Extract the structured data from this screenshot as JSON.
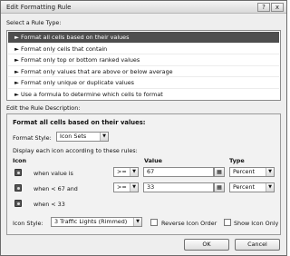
{
  "window": {
    "title": "Edit Formatting Rule",
    "help_glyph": "?",
    "close_glyph": "x"
  },
  "select_rule_type": {
    "label": "Select a Rule Type:",
    "items": [
      {
        "label": "Format all cells based on their values"
      },
      {
        "label": "Format only cells that contain"
      },
      {
        "label": "Format only top or bottom ranked values"
      },
      {
        "label": "Format only values that are above or below average"
      },
      {
        "label": "Format only unique or duplicate values"
      },
      {
        "label": "Use a formula to determine which cells to format"
      }
    ],
    "selected_index": 0,
    "arrow_glyph": "►"
  },
  "edit_rule": {
    "label": "Edit the Rule Description:",
    "heading": "Format all cells based on their values:",
    "format_style_label": "Format Style:",
    "format_style_value": "Icon Sets",
    "display_text": "Display each icon according to these rules:",
    "col_icon": "Icon",
    "col_value": "Value",
    "col_type": "Type",
    "rows": [
      {
        "condition": "when value is",
        "operator": ">=",
        "value": "67",
        "type": "Percent"
      },
      {
        "condition": "when < 67 and",
        "operator": ">=",
        "value": "33",
        "type": "Percent"
      },
      {
        "condition": "when < 33"
      }
    ],
    "icon_style_label": "Icon Style:",
    "icon_style_value": "3 Traffic Lights (Rimmed)",
    "reverse_label": "Reverse Icon Order",
    "show_only_label": "Show Icon Only",
    "dropdown_glyph": "▼",
    "ref_glyph": "▦"
  },
  "buttons": {
    "ok": "OK",
    "cancel": "Cancel"
  }
}
